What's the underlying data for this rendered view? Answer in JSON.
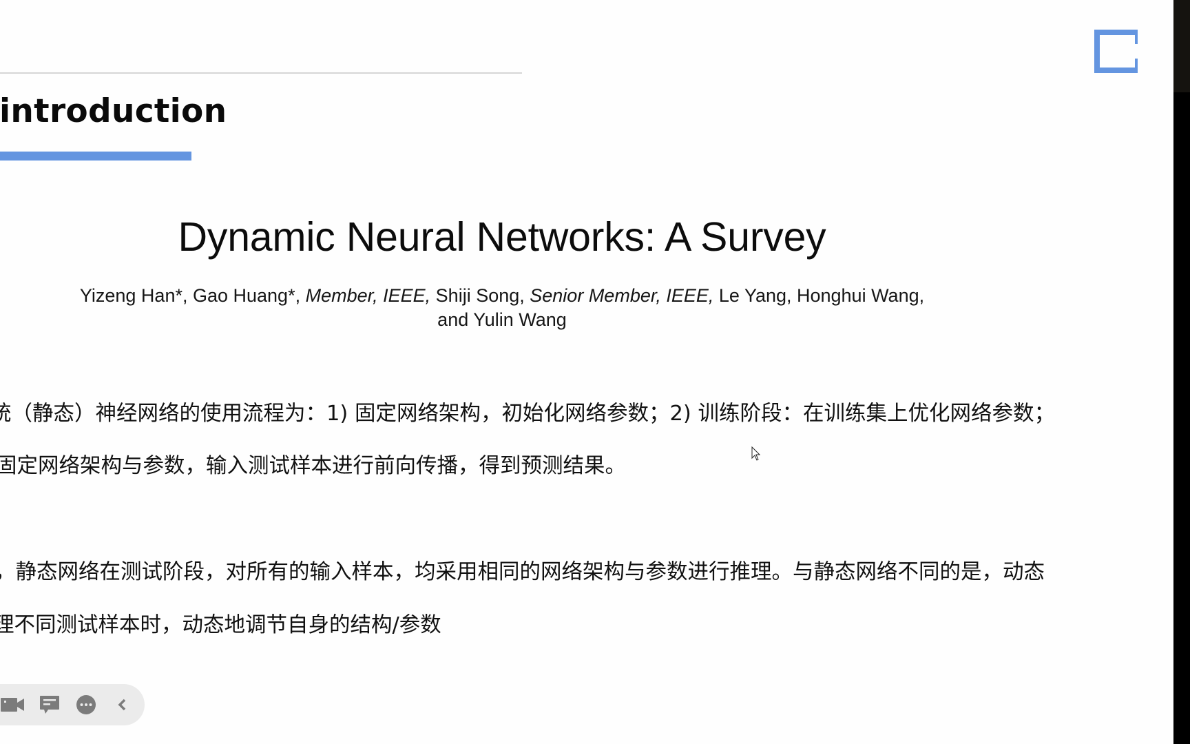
{
  "slide": {
    "section_heading": "introduction",
    "paper_title": "Dynamic Neural Networks: A Survey",
    "authors": {
      "line1": {
        "a1": "Yizeng Han*, Gao Huang*, ",
        "a1_role": "Member, IEEE,",
        "a2": " Shiji Song, ",
        "a2_role": "Senior Member, IEEE,",
        "a3": " Le Yang, Honghui Wang,"
      },
      "line2": "and Yulin Wang"
    },
    "body_lines": [
      "统（静态）神经网络的使用流程为：1) 固定网络架构，初始化网络参数；2) 训练阶段：在训练集上优化网络参数；",
      "固定网络架构与参数，输入测试样本进行前向传播，得到预测结果。",
      "，静态网络在测试阶段，对所有的输入样本，均采用相同的网络架构与参数进行推理。与静态网络不同的是，动态",
      "理不同测试样本时，动态地调节自身的结构/参数"
    ],
    "accent_color": "#6495e0"
  },
  "toolbar": {
    "buttons": [
      {
        "icon": "video-camera-icon",
        "label": "Video"
      },
      {
        "icon": "chat-icon",
        "label": "Chat"
      },
      {
        "icon": "more-icon",
        "label": "More"
      },
      {
        "icon": "chevron-left-icon",
        "label": "Collapse"
      }
    ]
  },
  "icons": {
    "corner_logo": "bracket-logo-icon",
    "cursor": "mouse-pointer-icon"
  }
}
